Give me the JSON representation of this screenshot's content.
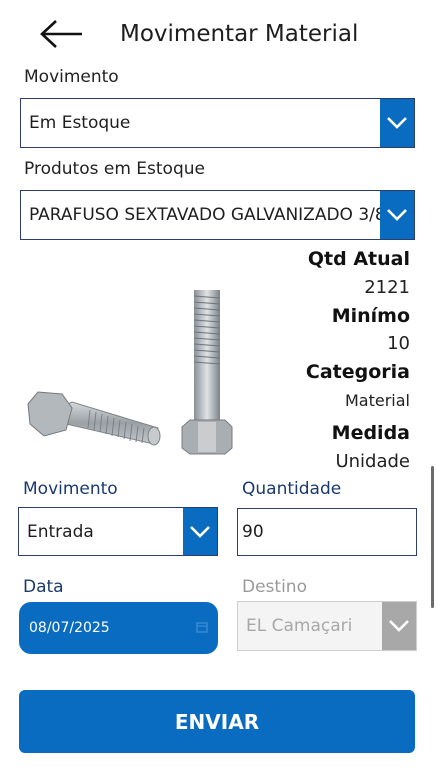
{
  "header": {
    "title": "Movimentar Material"
  },
  "movimento_top": {
    "label": "Movimento",
    "value": "Em Estoque"
  },
  "produtos": {
    "label": "Produtos em Estoque",
    "value": "PARAFUSO SEXTAVADO GALVANIZADO 3/8"
  },
  "info": {
    "qtd_label": "Qtd Atual",
    "qtd_value": "2121",
    "min_label": "Minímo",
    "min_value": "10",
    "cat_label": "Categoria",
    "cat_value": "Material",
    "medida_label": "Medida",
    "medida_value": "Unidade"
  },
  "movimento": {
    "label": "Movimento",
    "value": "Entrada"
  },
  "quantidade": {
    "label": "Quantidade",
    "value": "90"
  },
  "data": {
    "label": "Data",
    "value": "08/07/2025"
  },
  "destino": {
    "label": "Destino",
    "value": "EL Camaçari"
  },
  "submit": {
    "label": "ENVIAR"
  },
  "colors": {
    "accent": "#0a6cc0",
    "label_blue": "#1a3a6e",
    "disabled": "#a8a8a8"
  }
}
